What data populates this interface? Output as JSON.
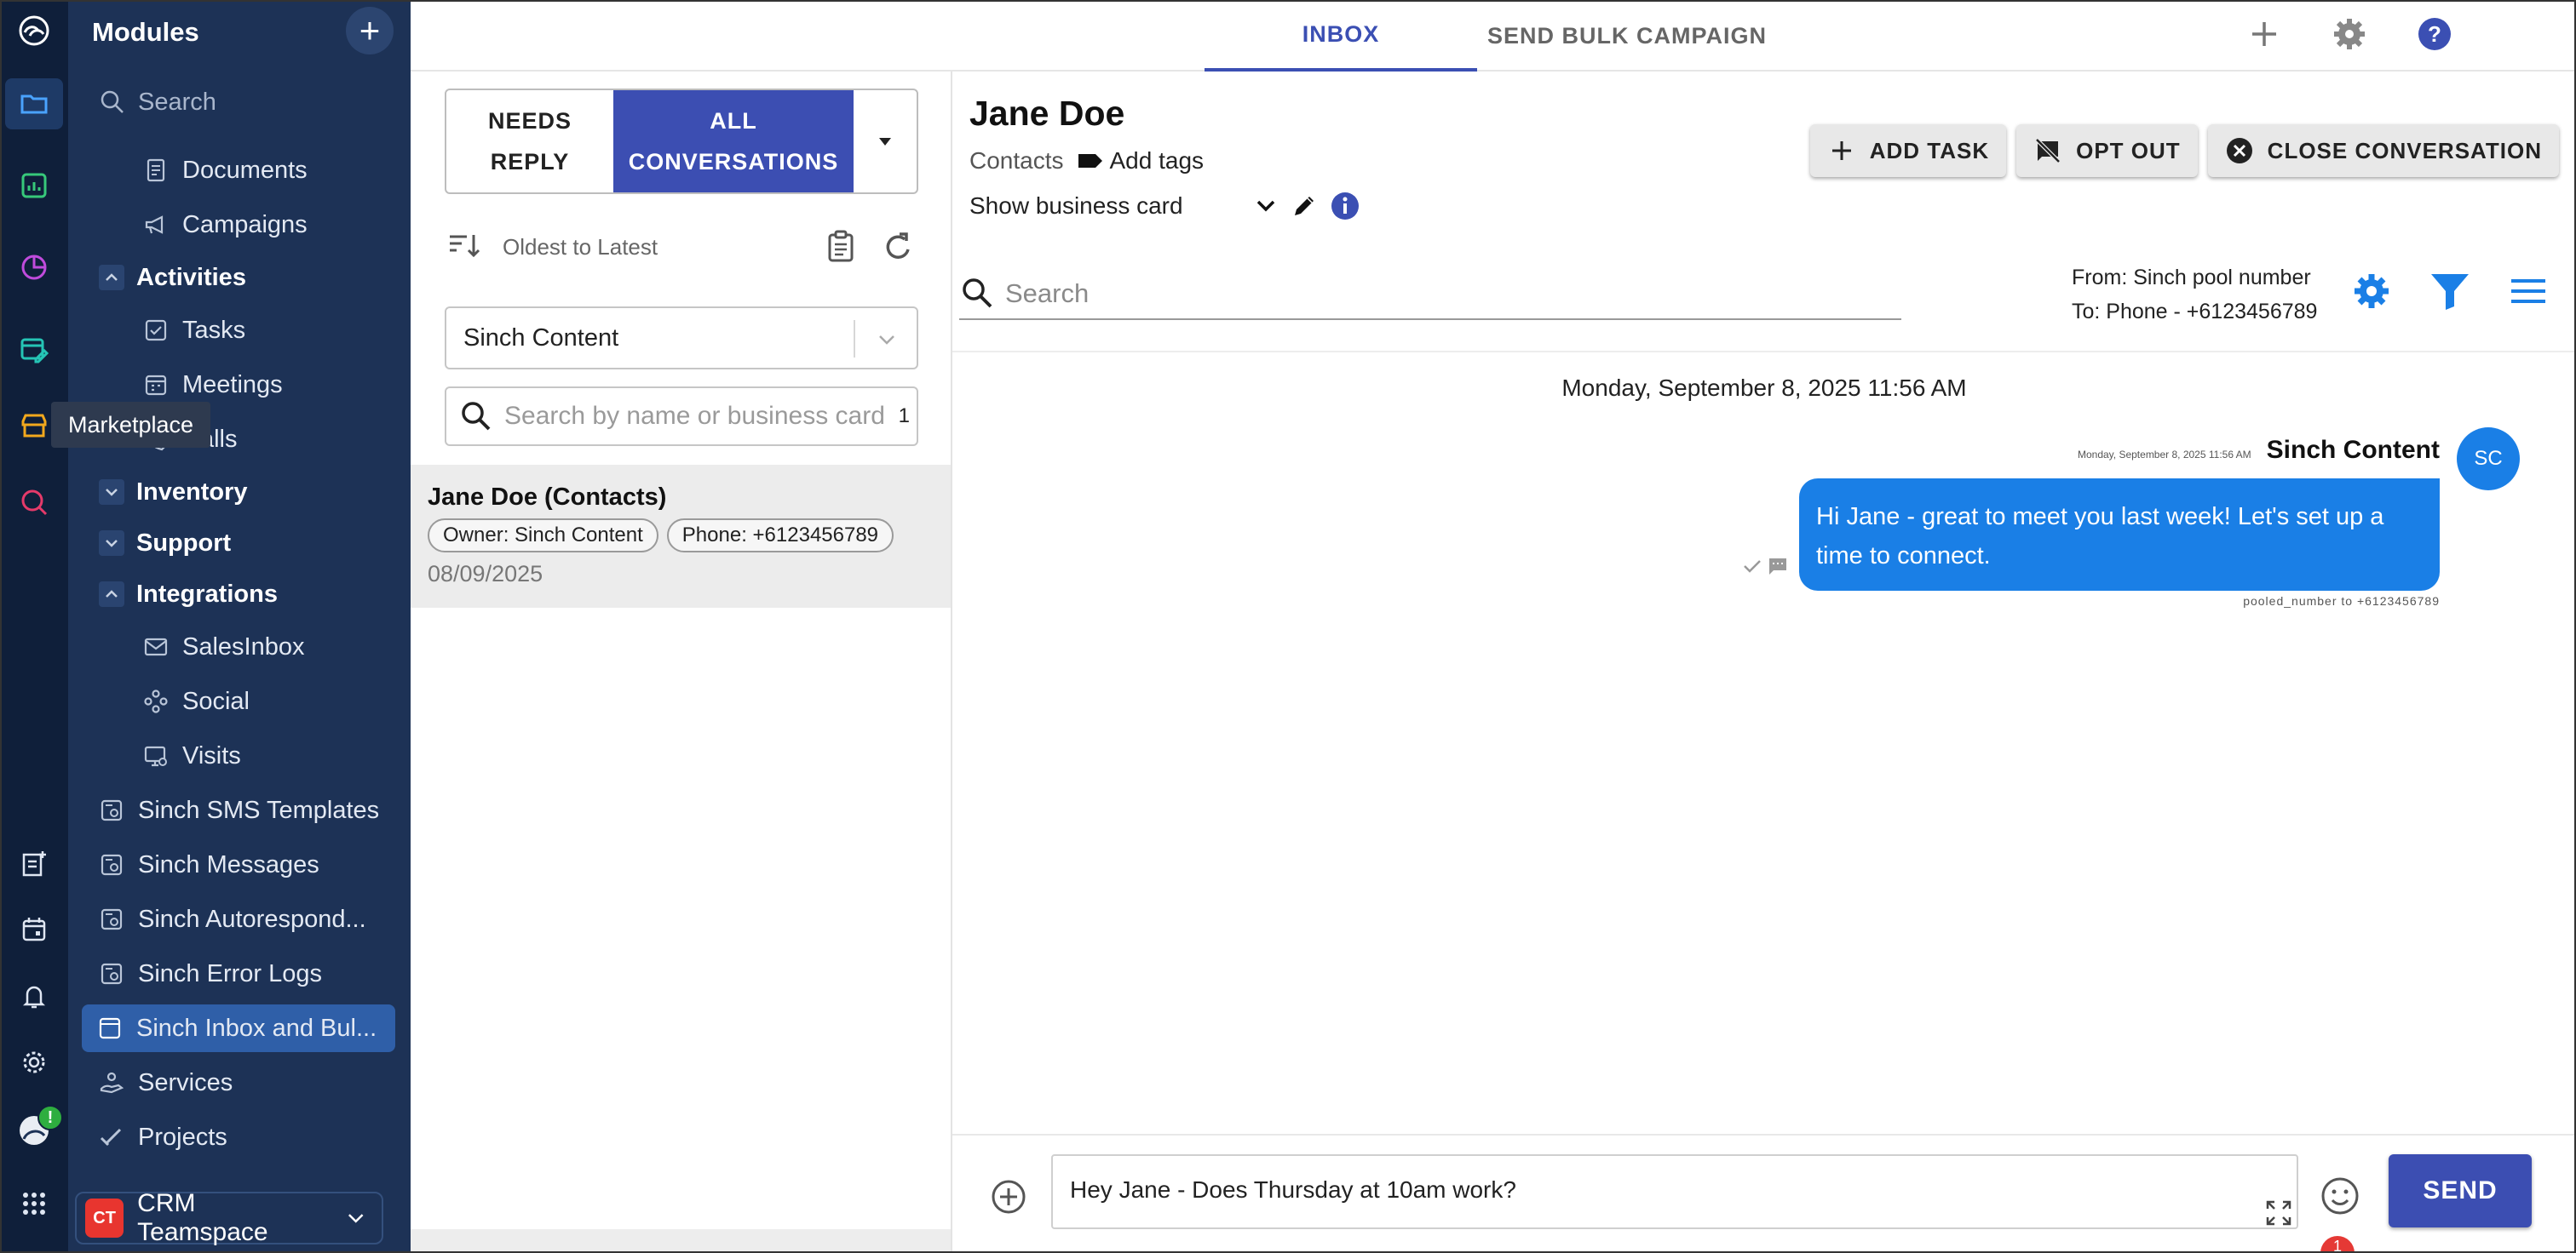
{
  "rail": {
    "icons": [
      "cloud-logo-icon",
      "folder-icon",
      "report-icon",
      "analytics-icon",
      "calendar-edit-icon",
      "marketplace-icon",
      "search-analytics-icon",
      "new-note-icon",
      "calendar-icon",
      "bell-icon",
      "gear-icon",
      "avatar",
      "apps-grid-icon"
    ],
    "tooltip": "Marketplace",
    "status_badge": "!"
  },
  "modules": {
    "title": "Modules",
    "add_label": "+",
    "search_placeholder": "Search",
    "items": [
      {
        "label": "Documents",
        "level": 2
      },
      {
        "label": "Campaigns",
        "level": 2
      },
      {
        "label": "Activities",
        "level": 1,
        "group": true,
        "expanded": true
      },
      {
        "label": "Tasks",
        "level": 2
      },
      {
        "label": "Meetings",
        "level": 2
      },
      {
        "label": "Calls",
        "level": 2
      },
      {
        "label": "Inventory",
        "level": 1,
        "group": true,
        "expanded": false
      },
      {
        "label": "Support",
        "level": 1,
        "group": true,
        "expanded": false
      },
      {
        "label": "Integrations",
        "level": 1,
        "group": true,
        "expanded": true
      },
      {
        "label": "SalesInbox",
        "level": 2
      },
      {
        "label": "Social",
        "level": 2
      },
      {
        "label": "Visits",
        "level": 2
      },
      {
        "label": "Sinch SMS Templates",
        "level": 1
      },
      {
        "label": "Sinch Messages",
        "level": 1
      },
      {
        "label": "Sinch Autorespond...",
        "level": 1
      },
      {
        "label": "Sinch Error Logs",
        "level": 1
      },
      {
        "label": "Sinch Inbox and Bul...",
        "level": 1,
        "selected": true
      },
      {
        "label": "Services",
        "level": 1
      },
      {
        "label": "Projects",
        "level": 1
      }
    ],
    "team": {
      "badge": "CT",
      "name": "CRM Teamspace"
    }
  },
  "topbar": {
    "tabs": [
      {
        "label": "INBOX",
        "active": true
      },
      {
        "label": "SEND BULK CAMPAIGN",
        "active": false
      }
    ]
  },
  "list": {
    "filter_needs_reply": "NEEDS REPLY",
    "filter_all": "ALL CONVERSATIONS",
    "sort_label": "Oldest to Latest",
    "owner_selected": "Sinch Content",
    "search_placeholder": "Search by name or business card",
    "search_count": "1",
    "conversations": [
      {
        "name": "Jane Doe (Contacts)",
        "owner_chip": "Owner: Sinch Content",
        "phone_chip": "Phone: +6123456789",
        "date": "08/09/2025"
      }
    ]
  },
  "conversation": {
    "contact_name": "Jane Doe",
    "module": "Contacts",
    "add_tags": "Add tags",
    "business_card": "Show business card",
    "actions": {
      "add_task": "ADD TASK",
      "opt_out": "OPT OUT",
      "close": "CLOSE CONVERSATION"
    },
    "search_placeholder": "Search",
    "from": "From: Sinch pool number",
    "to": "To: Phone - +6123456789",
    "day_label": "Monday, September 8, 2025 11:56 AM",
    "messages": [
      {
        "sender": "Sinch Content",
        "avatar": "SC",
        "timestamp": "Monday, September 8, 2025 11:56 AM",
        "text": "Hi Jane - great to meet you last week! Let's set up a time to connect.",
        "route": "pooled_number to +6123456789"
      }
    ],
    "composer": {
      "text": "Hey Jane - Does Thursday at 10am work?",
      "send_label": "SEND",
      "badge": "1"
    }
  },
  "colors": {
    "rail_bg": "#0f1f3a",
    "sidebar_bg": "#1d3256",
    "accent": "#3c4eb2",
    "bubble": "#1a7fe6",
    "selected_item": "#2f5fa8"
  }
}
